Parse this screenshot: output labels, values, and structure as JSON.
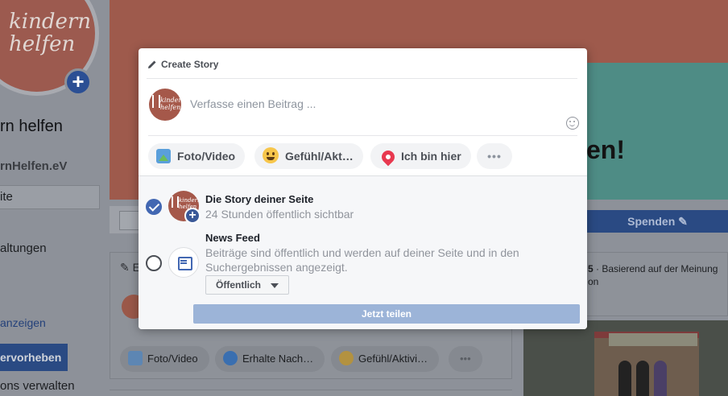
{
  "background": {
    "logo_text": "kindern helfen",
    "page_name": "rn helfen",
    "page_handle": "rnHelfen.eV",
    "tab_active": "ite",
    "tab_events": "altungen",
    "link_show": "anzeigen",
    "promote_button": "ervorheben",
    "manage_link": "ons verwalten",
    "cover_text": "en!",
    "donate_button": "Spenden",
    "post_card": {
      "header_letter": "E",
      "buttons": [
        {
          "label": "Foto/Video",
          "icon": "photo-icon"
        },
        {
          "label": "Erhalte Nach…",
          "icon": "messenger-icon"
        },
        {
          "label": "Gefühl/Aktivi…",
          "icon": "feeling-icon"
        },
        {
          "label": "•••",
          "icon": "more-icon"
        }
      ]
    },
    "rating_text_bold": "5",
    "rating_text": "· Basierend auf der Meinung",
    "rating_text_2": "on"
  },
  "modal": {
    "title": "Create Story",
    "composer_placeholder": "Verfasse einen Beitrag ...",
    "avatar_text": "kindern helfen",
    "actions": [
      {
        "label": "Foto/Video",
        "icon": "photo-video-icon"
      },
      {
        "label": "Gefühl/Akt…",
        "icon": "feeling-icon"
      },
      {
        "label": "Ich bin hier",
        "icon": "location-pin-icon"
      },
      {
        "label": "•••",
        "icon": "more-icon"
      }
    ],
    "option_story": {
      "title": "Die Story deiner Seite",
      "subtitle": "24 Stunden öffentlich sichtbar",
      "selected": true
    },
    "option_feed": {
      "title": "News Feed",
      "subtitle": "Beiträge sind öffentlich und werden auf deiner Seite und in den Suchergebnissen angezeigt.",
      "selected": false
    },
    "privacy_select": "Öffentlich",
    "share_button": "Jetzt teilen"
  },
  "colors": {
    "brand_blue": "#4267b2",
    "share_disabled": "#9cb4d8",
    "overlay": "#8d9199"
  }
}
